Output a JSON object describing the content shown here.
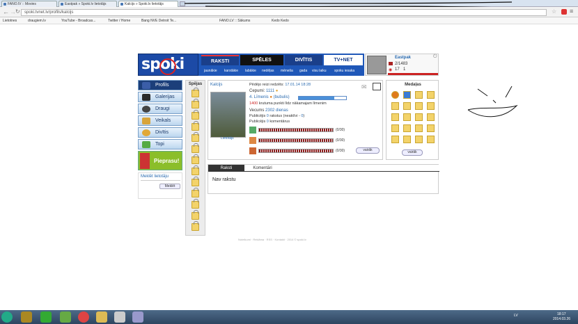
{
  "browser": {
    "tabs": [
      "FANO.lV :: Movies",
      "Eastpak » Spoki.lv lietotājs",
      "Kalcijs » Spoki.lv lietotājs"
    ],
    "url": "spoki.tvnet.lv/profils/kalcijs",
    "bookmarks": [
      "Lietotnes",
      "draugiem.lv",
      "YouTube - Broadcas...",
      "Twitter / Home",
      "Bang NVE Detroit Te...",
      "FANO.LV :: Sākums",
      "Kedo Kedo"
    ]
  },
  "site": {
    "logo": "spoki",
    "nav": [
      "RAKSTI",
      "SPĒLES",
      "DIVĪTIS",
      "TV+NET"
    ],
    "subnav": [
      "jaunākie",
      "karstākie",
      "labākie",
      "nedēļas",
      "mēneša",
      "gada",
      "visu laiku",
      "spoku iesaka"
    ],
    "user": {
      "name": "Eastpak",
      "stat1": "2/1483",
      "stat2": "17",
      "stat3": "1"
    }
  },
  "sidebar": {
    "items": [
      "Profils",
      "Galerijas",
      "Draugi",
      "Veikals",
      "Divītis",
      "Topi"
    ],
    "pieprasu": "Pieprasu!",
    "search_label": "Meklēt lietotāju",
    "search_button": "Meklēt"
  },
  "spejas": {
    "title": "Spējas"
  },
  "profile": {
    "name": "Kalcijs",
    "last_seen_label": "Pēdējo reizi redzēts:",
    "last_seen": "17.01.14 18:28",
    "cepumi_label": "Cepumi:",
    "cepumi": "1111",
    "level": "4. Līmenis",
    "level_name": "(bubulis)",
    "progress_pct": 0.75,
    "points_text": "1400",
    "points_rest": "krutuma punkti līdz nākamajam līmenim",
    "age_label": "Vecums",
    "age": "2302 dienas",
    "publ_label": "Publicējis",
    "publ_count": "0",
    "publ_rest": "rakstus",
    "publ_inactive": "0",
    "publ_inactive_text": "(neaktīvi -",
    "comments_count": "0",
    "comments_rest": "komentārus",
    "photo_caption": "Lietotājs",
    "bars": [
      "(0/30)",
      "(0/30)",
      "(0/30)"
    ],
    "more_button": "vairāk"
  },
  "medalas": {
    "title": "Medaļas",
    "more_button": "vairāk"
  },
  "content_tabs": {
    "tab1": "Raksti",
    "tab2": "Komentāri",
    "empty": "Nav rakstu"
  },
  "footer": "Noteikumi · Reklāma · RSS · Kontakti · 2014 © spoki.lv",
  "taskbar": {
    "lang": "LV",
    "time": "18:17",
    "date": "2014.03.26"
  }
}
